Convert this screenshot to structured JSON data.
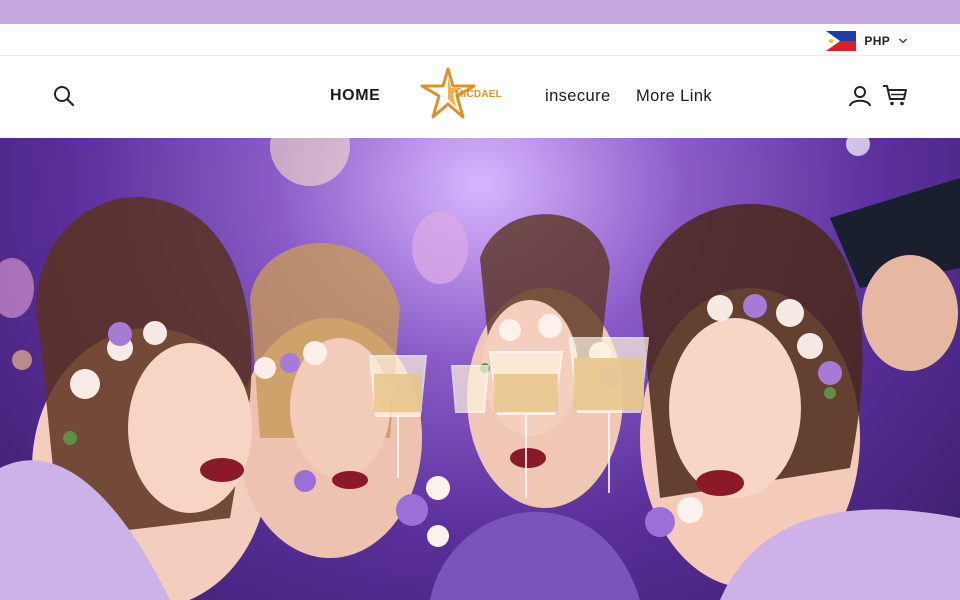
{
  "currency": {
    "code": "PHP"
  },
  "nav": {
    "home": "HOME",
    "logo_text": "MICDAEL",
    "insecure": "insecure",
    "more": "More Link"
  },
  "hero": {
    "image": "prom party celebration photo"
  },
  "colors": {
    "announcement_bar": "#c7a8df",
    "logo_accent": "#e0902a"
  }
}
